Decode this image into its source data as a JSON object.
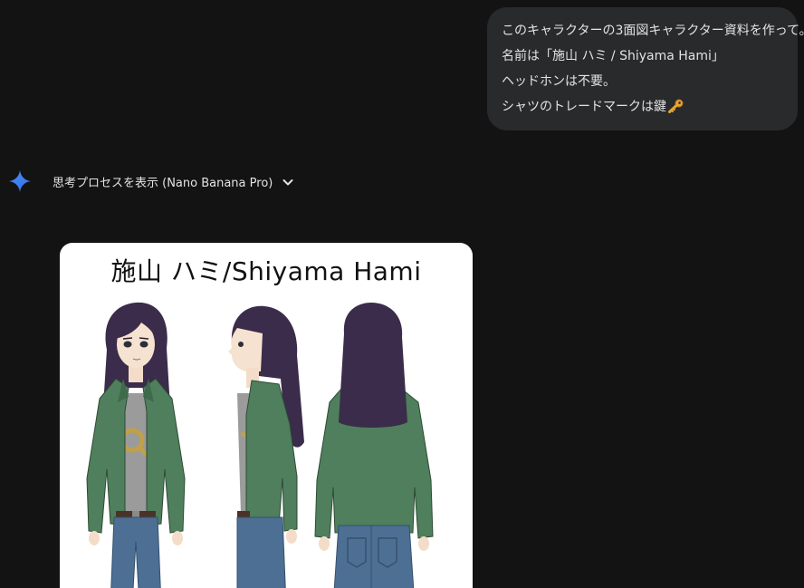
{
  "user_message": {
    "lines": [
      "このキャラクターの3面図キャラクター資料を作って。",
      "名前は「施山 ハミ / Shiyama Hami」",
      "ヘッドホンは不要。",
      "シャツのトレードマークは鍵"
    ],
    "trailing_icon": "key-emoji-icon"
  },
  "response": {
    "model_icon": "gemini-sparkle-icon",
    "thinking_toggle_label": "思考プロセスを表示 (Nano Banana Pro)",
    "toggle_icon": "chevron-down-icon"
  },
  "generated_image": {
    "title": "施山 ハミ/Shiyama Hami",
    "views": [
      "front",
      "side",
      "back"
    ]
  },
  "colors": {
    "background": "#131314",
    "bubble": "#282a2c",
    "text": "#e3e3e3",
    "gemini_blue": "#4285f4",
    "jacket": "#4f7f5c",
    "hair": "#3a2c4a",
    "jeans": "#4d6f93",
    "shirt": "#9b9b9b",
    "key_gold": "#c9a23a"
  }
}
